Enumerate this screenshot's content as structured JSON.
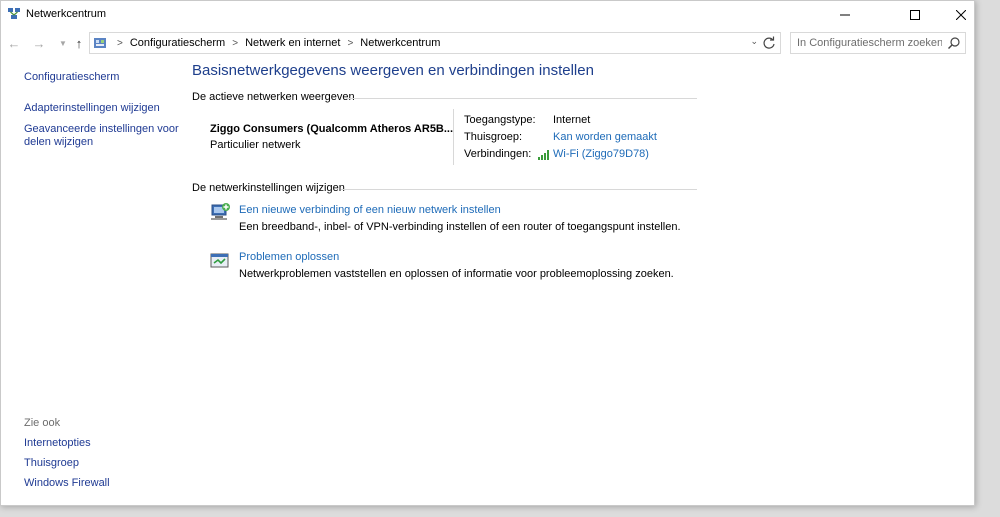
{
  "window": {
    "title": "Netwerkcentrum"
  },
  "address": {
    "breadcrumbs": [
      "Configuratiescherm",
      "Netwerk en internet",
      "Netwerkcentrum"
    ],
    "search_placeholder": "In Configuratiescherm zoeken"
  },
  "sidebar": {
    "home": "Configuratiescherm",
    "links": [
      "Adapterinstellingen wijzigen",
      "Geavanceerde instellingen voor",
      "delen wijzigen"
    ],
    "see_also_heading": "Zie ook",
    "see_also": [
      "Internetopties",
      "Thuisgroep",
      "Windows Firewall"
    ]
  },
  "main": {
    "title": "Basisnetwerkgegevens weergeven en verbindingen instellen",
    "active_heading": "De actieve netwerken weergeven",
    "network": {
      "name": "Ziggo Consumers (Qualcomm Atheros AR5B...",
      "type": "Particulier netwerk",
      "access_label": "Toegangstype:",
      "access_value": "Internet",
      "homegroup_label": "Thuisgroep:",
      "homegroup_value": "Kan worden gemaakt",
      "connections_label": "Verbindingen:",
      "connections_value": "Wi-Fi (Ziggo79D78)"
    },
    "change_heading": "De netwerkinstellingen wijzigen",
    "tasks": [
      {
        "link": "Een nieuwe verbinding of een nieuw netwerk instellen",
        "desc": "Een breedband-, inbel- of VPN-verbinding instellen of een router of toegangspunt instellen.",
        "icon": "new-connection-icon"
      },
      {
        "link": "Problemen oplossen",
        "desc": "Netwerkproblemen vaststellen en oplossen of informatie voor probleemoplossing zoeken.",
        "icon": "troubleshoot-icon"
      }
    ]
  },
  "colors": {
    "title_blue": "#1e3f8c",
    "link_blue": "#1e6bb8",
    "sidebar_link": "#1f3a93",
    "wifi_green": "#3a9b3a"
  }
}
